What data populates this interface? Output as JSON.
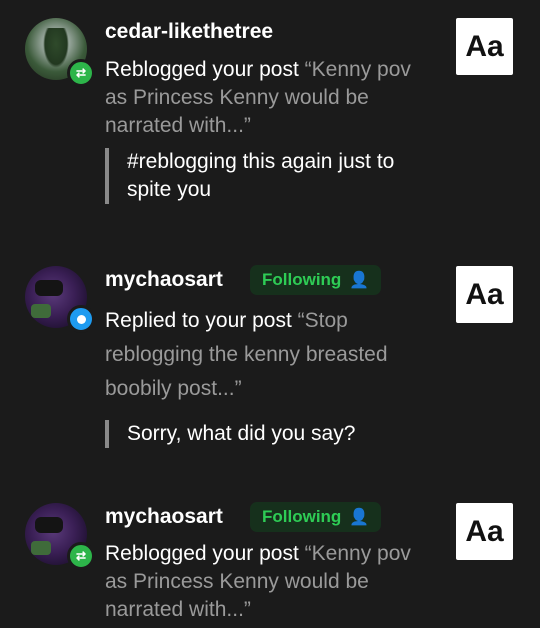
{
  "notifications": [
    {
      "username": "cedar-likethetree",
      "action": "Reblogged your post",
      "excerpt": "“Kenny pov as Princess Kenny would be narrated with...”",
      "quote": "#reblogging this again just to spite you",
      "thumb_label": "Aa",
      "type_icon": "reblog-icon"
    },
    {
      "username": "mychaosart",
      "following_label": "Following",
      "action": "Replied to your post",
      "excerpt": "“Stop reblogging the kenny breasted boobily post...”",
      "quote": "Sorry, what did you say?",
      "thumb_label": "Aa",
      "type_icon": "reply-icon"
    },
    {
      "username": "mychaosart",
      "following_label": "Following",
      "action": "Reblogged your post",
      "excerpt": "“Kenny pov as Princess Kenny would be narrated with...”",
      "thumb_label": "Aa",
      "type_icon": "reblog-icon"
    }
  ],
  "colors": {
    "background": "#1b1b1b",
    "following_text": "#2ecc55",
    "reblog_badge": "#2db54a",
    "reply_badge": "#1e9bf0"
  }
}
